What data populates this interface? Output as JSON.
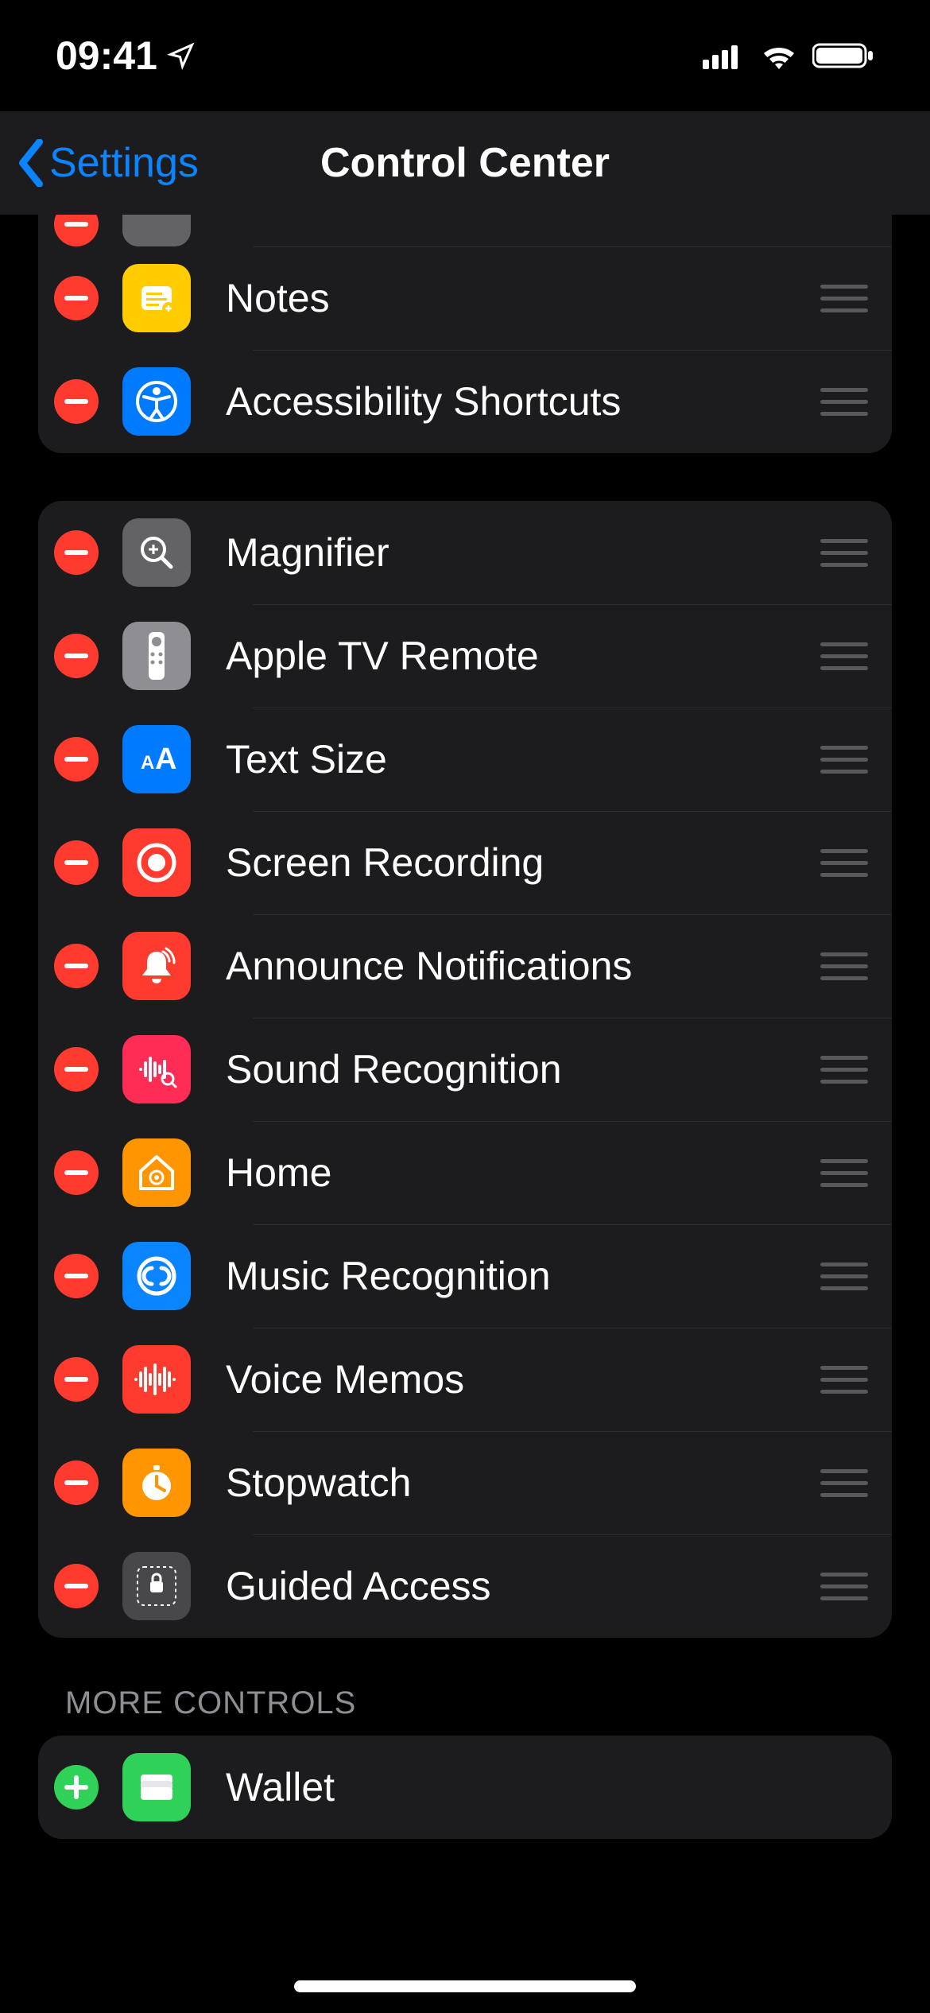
{
  "status": {
    "time": "09:41"
  },
  "nav": {
    "back_label": "Settings",
    "title": "Control Center"
  },
  "included_group1": [
    {
      "label": "Notes",
      "icon": "notes",
      "bg": "bg-yellow"
    },
    {
      "label": "Accessibility Shortcuts",
      "icon": "accessibility",
      "bg": "bg-blue"
    }
  ],
  "included_group2": [
    {
      "label": "Magnifier",
      "icon": "magnifier",
      "bg": "bg-gray"
    },
    {
      "label": "Apple TV Remote",
      "icon": "remote",
      "bg": "bg-lightgray"
    },
    {
      "label": "Text Size",
      "icon": "textsize",
      "bg": "bg-blue"
    },
    {
      "label": "Screen Recording",
      "icon": "record",
      "bg": "bg-red"
    },
    {
      "label": "Announce Notifications",
      "icon": "announce",
      "bg": "bg-red"
    },
    {
      "label": "Sound Recognition",
      "icon": "sound",
      "bg": "bg-pink"
    },
    {
      "label": "Home",
      "icon": "home",
      "bg": "bg-orange"
    },
    {
      "label": "Music Recognition",
      "icon": "shazam",
      "bg": "bg-blue2"
    },
    {
      "label": "Voice Memos",
      "icon": "voicememo",
      "bg": "bg-red"
    },
    {
      "label": "Stopwatch",
      "icon": "stopwatch",
      "bg": "bg-orange"
    },
    {
      "label": "Guided Access",
      "icon": "guided",
      "bg": "bg-gray2"
    }
  ],
  "more_header": "MORE CONTROLS",
  "more_controls": [
    {
      "label": "Wallet",
      "icon": "wallet",
      "bg": "bg-green"
    }
  ]
}
